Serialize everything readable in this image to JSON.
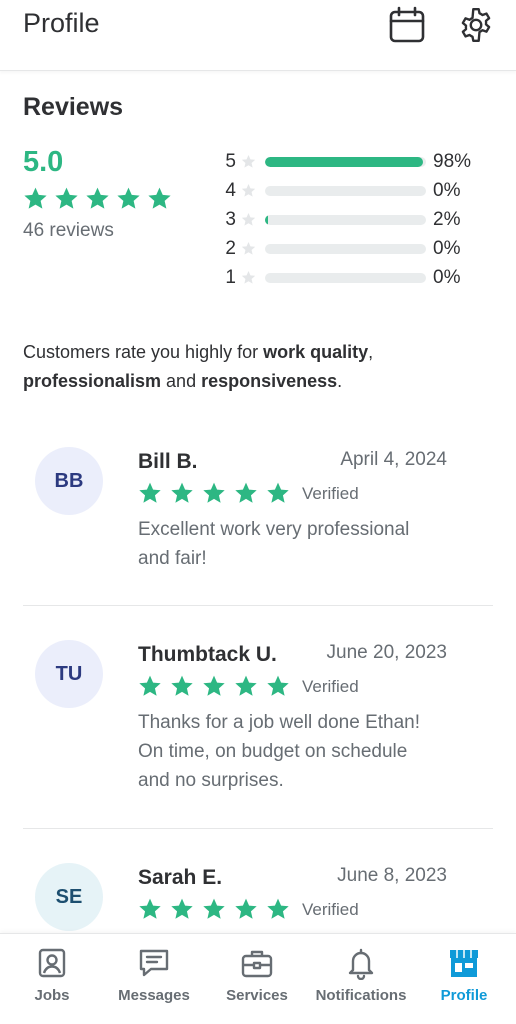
{
  "header": {
    "title": "Profile",
    "icons": [
      "calendar-icon",
      "gear-icon"
    ]
  },
  "reviews": {
    "heading": "Reviews",
    "average": "5.0",
    "average_stars": 5,
    "count_label": "46 reviews",
    "distribution": [
      {
        "stars": "5",
        "percent_label": "98%",
        "percent": 98
      },
      {
        "stars": "4",
        "percent_label": "0%",
        "percent": 0
      },
      {
        "stars": "3",
        "percent_label": "2%",
        "percent": 2
      },
      {
        "stars": "2",
        "percent_label": "0%",
        "percent": 0
      },
      {
        "stars": "1",
        "percent_label": "0%",
        "percent": 0
      }
    ],
    "summary": {
      "prefix": "Customers rate you highly for ",
      "q1": "work quality",
      "sep1": ", ",
      "q2": "professionalism",
      "sep2": " and ",
      "q3": "responsiveness",
      "suffix": "."
    }
  },
  "review_list": [
    {
      "initials": "BB",
      "name": "Bill B.",
      "date": "April 4, 2024",
      "rating": 5,
      "verified": "Verified",
      "text_lines": [
        "Excellent work very professional",
        "and fair!"
      ]
    },
    {
      "initials": "TU",
      "name": "Thumbtack U.",
      "date": "June 20, 2023",
      "rating": 5,
      "verified": "Verified",
      "text_lines": [
        "Thanks for a job well done Ethan!",
        "On time, on budget on schedule",
        "and no surprises."
      ]
    },
    {
      "initials": "SE",
      "name": "Sarah E.",
      "date": "June 8, 2023",
      "rating": 5,
      "verified": "Verified",
      "text_lines": []
    }
  ],
  "nav": {
    "items": [
      {
        "label": "Jobs",
        "icon": "jobs-icon"
      },
      {
        "label": "Messages",
        "icon": "messages-icon"
      },
      {
        "label": "Services",
        "icon": "services-icon"
      },
      {
        "label": "Notifications",
        "icon": "bell-icon"
      },
      {
        "label": "Profile",
        "icon": "profile-storefront-icon",
        "active": true
      }
    ]
  },
  "colors": {
    "accent_green": "#2db783",
    "active_blue": "#0f9ad8",
    "muted_text": "#676d73"
  }
}
